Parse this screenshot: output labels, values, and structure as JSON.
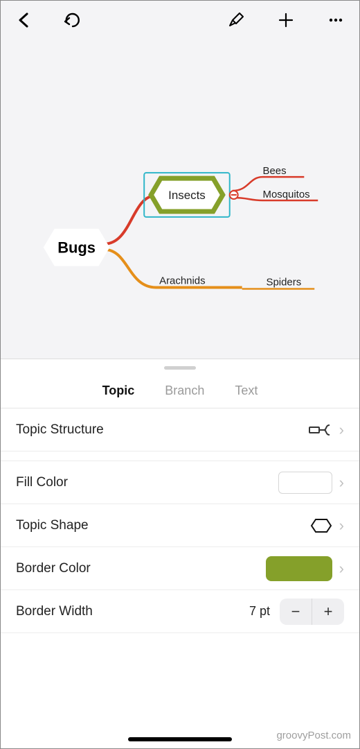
{
  "toolbar": {
    "back_icon": "back",
    "undo_icon": "undo",
    "format_icon": "format",
    "add_icon": "add",
    "more_icon": "more"
  },
  "mindmap": {
    "root": "Bugs",
    "children": [
      {
        "label": "Insects",
        "color": "#85a02a",
        "selected": true,
        "children": [
          {
            "label": "Bees",
            "color": "#d83b2a"
          },
          {
            "label": "Mosquitos",
            "color": "#d83b2a"
          }
        ]
      },
      {
        "label": "Arachnids",
        "color": "#e58f1a",
        "children": [
          {
            "label": "Spiders",
            "color": "#e58f1a"
          }
        ]
      }
    ]
  },
  "panel": {
    "tabs": {
      "topic": "Topic",
      "branch": "Branch",
      "text": "Text",
      "active": "topic"
    },
    "rows": {
      "structure": {
        "label": "Topic Structure"
      },
      "fill": {
        "label": "Fill Color",
        "value": "#ffffff"
      },
      "shape": {
        "label": "Topic Shape",
        "value": "hexagon"
      },
      "border_color": {
        "label": "Border Color",
        "value": "#85a02a"
      },
      "border_width": {
        "label": "Border Width",
        "value": "7 pt"
      }
    }
  },
  "watermark": "groovyPost.com"
}
